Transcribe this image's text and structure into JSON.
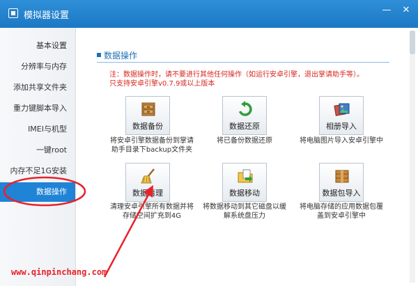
{
  "window": {
    "title": "模拟器设置",
    "minimize_label": "—",
    "close_label": "✕"
  },
  "sidebar": {
    "items": [
      {
        "label": "基本设置"
      },
      {
        "label": "分辨率与内存"
      },
      {
        "label": "添加共享文件夹"
      },
      {
        "label": "重力键脚本导入"
      },
      {
        "label": "IMEI与机型"
      },
      {
        "label": "一键root"
      },
      {
        "label": "内存不足1G安装"
      },
      {
        "label": "数据操作",
        "active": true
      }
    ]
  },
  "main": {
    "section_title": "数据操作",
    "notice_line1": "注：数据操作时，请不要进行其他任何操作（如运行安卓引擎，退出掌请助手等）。",
    "notice_line2": "只支持安卓引擎v0.7.9或以上版本",
    "tools": [
      {
        "label": "数据备份",
        "icon": "cabinet-icon",
        "desc_line1": "将安卓引擎数据备份到掌请",
        "desc_line2": "助手目录下backup文件夹"
      },
      {
        "label": "数据还原",
        "icon": "restore-arrow-icon",
        "desc_line1": "将已备份数据还原",
        "desc_line2": ""
      },
      {
        "label": "相册导入",
        "icon": "photo-album-icon",
        "desc_line1": "将电脑图片导入安卓引擎中",
        "desc_line2": ""
      },
      {
        "label": "数据清理",
        "icon": "broom-icon",
        "desc_line1": "清理安卓引擎所有数据并将",
        "desc_line2": "存储空间扩充到4G"
      },
      {
        "label": "数据移动",
        "icon": "move-folder-icon",
        "desc_line1": "将数据移动到其它磁盘以缓",
        "desc_line2": "解系统盘压力"
      },
      {
        "label": "数据包导入",
        "icon": "package-box-icon",
        "desc_line1": "将电脑存储的应用数据包覆",
        "desc_line2": "盖到安卓引擎中"
      }
    ]
  },
  "watermark": "www.qinpinchang.com",
  "colors": {
    "titlebar": "#1f83d6",
    "active_item": "#1f83d6",
    "notice_text": "#d7261e",
    "annotation_red": "#e8212a"
  }
}
